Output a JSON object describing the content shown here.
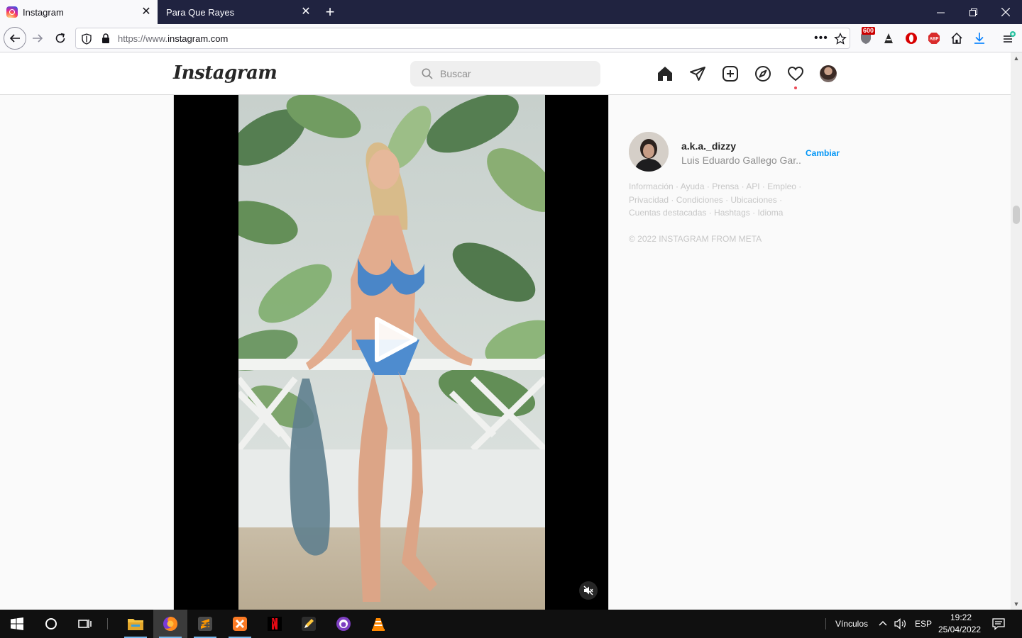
{
  "browser": {
    "tabs": [
      {
        "title": "Instagram",
        "active": true
      },
      {
        "title": "Para Que Rayes",
        "active": false
      }
    ],
    "url_prefix": "https://www.",
    "url_domain": "instagram.com",
    "ublock_badge": "600"
  },
  "instagram": {
    "logo": "Instagram",
    "search_placeholder": "Buscar",
    "nav_icons": [
      "home-icon",
      "direct-icon",
      "new-post-icon",
      "explore-icon",
      "activity-icon",
      "profile-avatar"
    ]
  },
  "sidebar": {
    "username": "a.k.a._dizzy",
    "full_name": "Luis Eduardo Gallego Gar...",
    "switch_label": "Cambiar",
    "footer_links": [
      "Información",
      "Ayuda",
      "Prensa",
      "API",
      "Empleo",
      "Privacidad",
      "Condiciones",
      "Ubicaciones",
      "Cuentas destacadas",
      "Hashtags",
      "Idioma"
    ],
    "copyright": "© 2022 INSTAGRAM FROM META"
  },
  "taskbar": {
    "links_label": "Vínculos",
    "language": "ESP",
    "time": "19:22",
    "date": "25/04/2022"
  },
  "colors": {
    "tabstrip": "#202340",
    "accent_blue": "#0095f6",
    "notification_dot": "#ed4956"
  }
}
